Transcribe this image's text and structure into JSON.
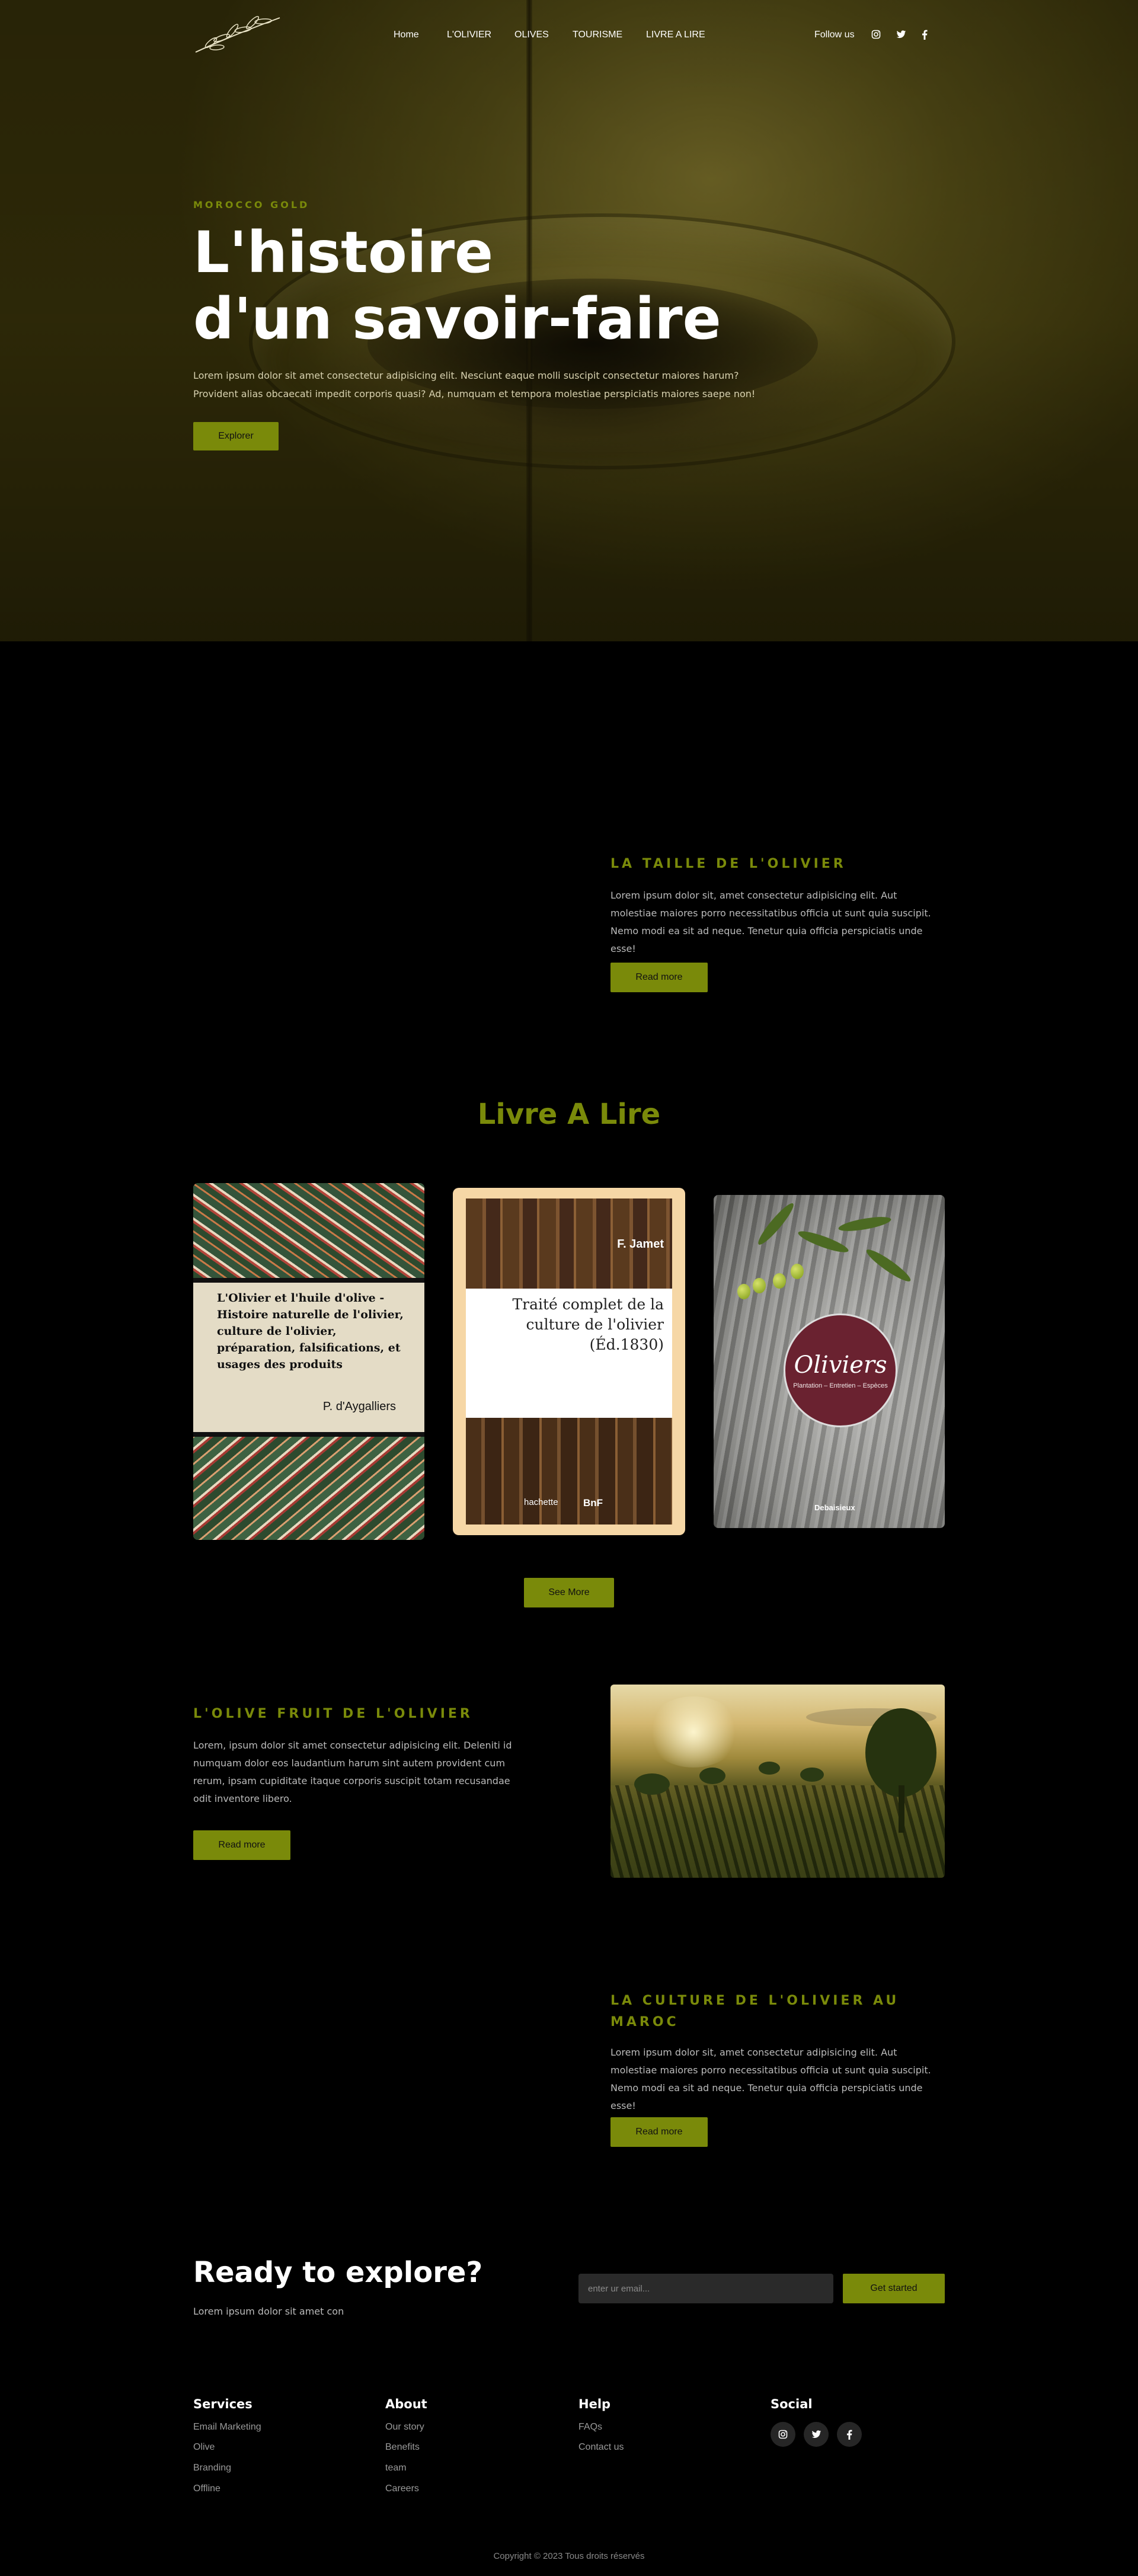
{
  "nav": {
    "logo_icon": "olive-branch-icon",
    "links": [
      "Home",
      "L'OLIVIER",
      "OLIVES",
      "TOURISME",
      "LIVRE A LIRE"
    ],
    "follow_label": "Follow us",
    "social_icons": [
      "instagram-icon",
      "twitter-icon",
      "facebook-icon"
    ]
  },
  "hero": {
    "eyebrow": "MOROCCO GOLD",
    "title_line1": "L'histoire",
    "title_line2": "d'un savoir-faire",
    "description": "Lorem ipsum dolor sit amet consectetur adipisicing elit. Nesciunt eaque molli suscipit consectetur maiores harum? Provident alias obcaecati impedit corporis quasi? Ad, numquam et tempora molestiae perspiciatis maiores saepe non!",
    "button": "Explorer"
  },
  "section_taille": {
    "title": "LA TAILLE DE L'OLIVIER",
    "text": "Lorem ipsum dolor sit, amet consectetur adipisicing elit. Aut molestiae maiores porro necessitatibus officia ut sunt quia suscipit. Nemo modi ea sit ad neque. Tenetur quia officia perspiciatis unde esse!",
    "button": "Read more"
  },
  "books": {
    "title": "Livre A Lire",
    "book1": {
      "title": "L'Olivier et l'huile d'olive - Histoire naturelle de l'olivier, culture de l'olivier, préparation, falsifications, et usages des produits",
      "author": "P. d'Aygalliers"
    },
    "book2": {
      "author": "F. Jamet",
      "title": "Traité complet de la culture de l'olivier (Éd.1830)",
      "publisher": "hachette",
      "library": "BnF"
    },
    "book3": {
      "title": "Oliviers",
      "subtitle": "Plantation – Entretien – Espèces",
      "publisher": "Debaisieux"
    },
    "button": "See More"
  },
  "section_olive": {
    "title": "L'OLIVE FRUIT DE L'OLIVIER",
    "text": "Lorem, ipsum dolor sit amet consectetur adipisicing elit. Deleniti id numquam dolor eos laudantium harum sint autem provident cum rerum, ipsam cupiditate itaque corporis suscipit totam recusandae odit inventore libero.",
    "button": "Read more"
  },
  "section_culture": {
    "title_line1": "LA CULTURE DE L'OLIVIER AU",
    "title_line2": "MAROC",
    "text": "Lorem ipsum dolor sit, amet consectetur adipisicing elit. Aut molestiae maiores porro necessitatibus officia ut sunt quia suscipit. Nemo modi ea sit ad neque. Tenetur quia officia perspiciatis unde esse!",
    "button": "Read more"
  },
  "cta": {
    "title": "Ready to explore?",
    "subtitle": "Lorem ipsum dolor sit amet con",
    "email_placeholder": "enter ur email...",
    "button": "Get started"
  },
  "footer": {
    "columns": [
      {
        "heading": "Services",
        "links": [
          "Email Marketing",
          "Olive",
          "Branding",
          "Offline"
        ]
      },
      {
        "heading": "About",
        "links": [
          "Our story",
          "Benefits",
          "team",
          "Careers"
        ]
      },
      {
        "heading": "Help",
        "links": [
          "FAQs",
          "Contact us"
        ]
      },
      {
        "heading": "Social",
        "links": []
      }
    ],
    "social_icons": [
      "instagram-icon",
      "twitter-icon",
      "facebook-icon"
    ],
    "copyright": "Copyright © 2023 Tous droits réservés"
  },
  "colors": {
    "accent": "#7a8a0a",
    "background": "#000000",
    "body_text": "#bbbbbb"
  }
}
